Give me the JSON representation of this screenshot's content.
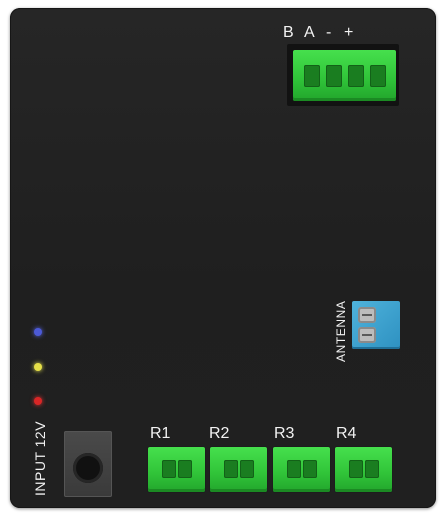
{
  "rs485_labels": [
    "B",
    "A",
    "-",
    "+"
  ],
  "antenna_label": "ANTENNA",
  "input_label": "INPUT 12V",
  "relay_labels": [
    "R1",
    "R2",
    "R3",
    "R4"
  ],
  "led_colors": {
    "blue": "#4c5ad8",
    "yellow": "#e6e048",
    "red": "#d92626"
  },
  "terminal_color": "#33c63b",
  "antenna_terminal_color": "#3aa0cf",
  "case_color": "#232323"
}
